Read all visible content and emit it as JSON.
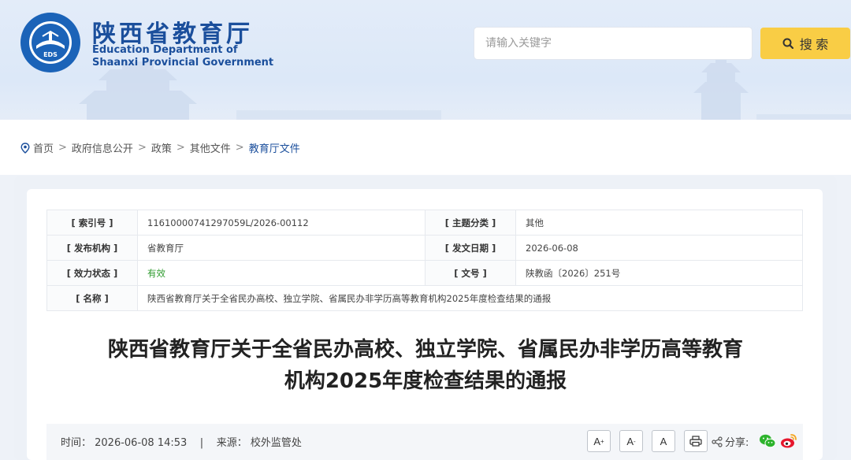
{
  "header": {
    "title_cn": "陕西省教育厅",
    "title_en_line1": "Education Department of",
    "title_en_line2": "Shaanxi Provincial Government",
    "logo_text": "EDS",
    "logo_ring_top": "EDUCATION DEPARTMENT OF SHAANXI",
    "logo_ring_bottom": "陕西省教育厅"
  },
  "search": {
    "placeholder": "请输入关键字",
    "button_label": "搜 索"
  },
  "breadcrumb": {
    "items": [
      "首页",
      "政府信息公开",
      "政策",
      "其他文件",
      "教育厅文件"
    ],
    "separator": ">"
  },
  "meta": {
    "index_key": "[ 索引号 ]",
    "index_value": "11610000741297059L/2026-00112",
    "topic_key": "[ 主题分类 ]",
    "topic_value": "其他",
    "publisher_key": "[ 发布机构 ]",
    "publisher_value": "省教育厅",
    "date_key": "[ 发文日期 ]",
    "date_value": "2026-06-08",
    "status_key": "[ 效力状态 ]",
    "status_value": "有效",
    "docno_key": "[ 文号 ]",
    "docno_value": "陕教函〔2026〕251号",
    "name_key": "[ 名称 ]",
    "name_value": "陕西省教育厅关于全省民办高校、独立学院、省属民办非学历高等教育机构2025年度检查结果的通报"
  },
  "article": {
    "title_line1": "陕西省教育厅关于全省民办高校、独立学院、省属民办非学历高等教育",
    "title_line2": "机构2025年度检查结果的通报",
    "info": "时间： 2026-06-08 14:53    |    来源： 校外监管处"
  },
  "toolbar": {
    "font_increase": "A",
    "font_increase_sup": "+",
    "font_decrease": "A",
    "font_decrease_sup": "-",
    "font_reset": "A",
    "share_label": "分享:"
  },
  "colors": {
    "brand": "#1b4f9c",
    "accent": "#f9cd45",
    "status_valid": "#2f9b2f"
  },
  "icons": [
    "location-icon",
    "search-icon",
    "print-icon",
    "share-icon",
    "wechat-icon",
    "weibo-icon"
  ]
}
